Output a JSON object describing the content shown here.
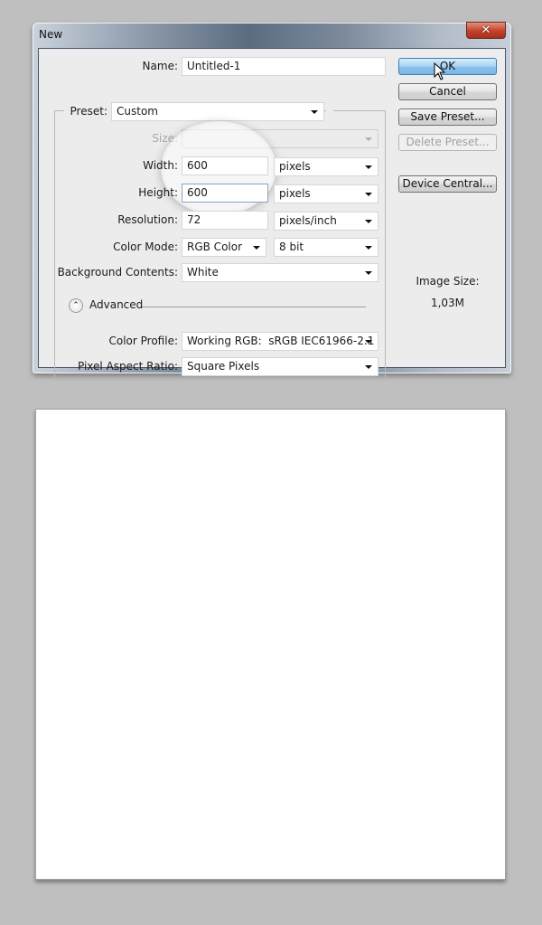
{
  "dialog": {
    "title": "New",
    "close_icon": "close-icon",
    "name": {
      "label": "Name:",
      "value": "Untitled-1"
    },
    "preset": {
      "label": "Preset:",
      "value": "Custom"
    },
    "size": {
      "label": "Size:",
      "value": ""
    },
    "width": {
      "label": "Width:",
      "value": "600",
      "unit": "pixels"
    },
    "height": {
      "label": "Height:",
      "value": "600",
      "unit": "pixels"
    },
    "resolution": {
      "label": "Resolution:",
      "value": "72",
      "unit": "pixels/inch"
    },
    "color_mode": {
      "label": "Color Mode:",
      "value": "RGB Color",
      "depth": "8 bit"
    },
    "background": {
      "label": "Background Contents:",
      "value": "White"
    },
    "advanced": {
      "label": "Advanced",
      "icon": "chevron-up-double-icon"
    },
    "color_profile": {
      "label": "Color Profile:",
      "value": "Working RGB:  sRGB IEC61966-2.1"
    },
    "pixel_aspect": {
      "label": "Pixel Aspect Ratio:",
      "value": "Square Pixels"
    },
    "buttons": {
      "ok": "OK",
      "cancel": "Cancel",
      "save_preset": "Save Preset...",
      "delete_preset": "Delete Preset...",
      "device_central": "Device Central..."
    },
    "image_size": {
      "label": "Image Size:",
      "value": "1,03M"
    }
  },
  "colors": {
    "workspace": "#bfbfbf",
    "dialog_body": "#ececec",
    "primary_button": "#8dc3ec",
    "close_button": "#c4412a"
  }
}
